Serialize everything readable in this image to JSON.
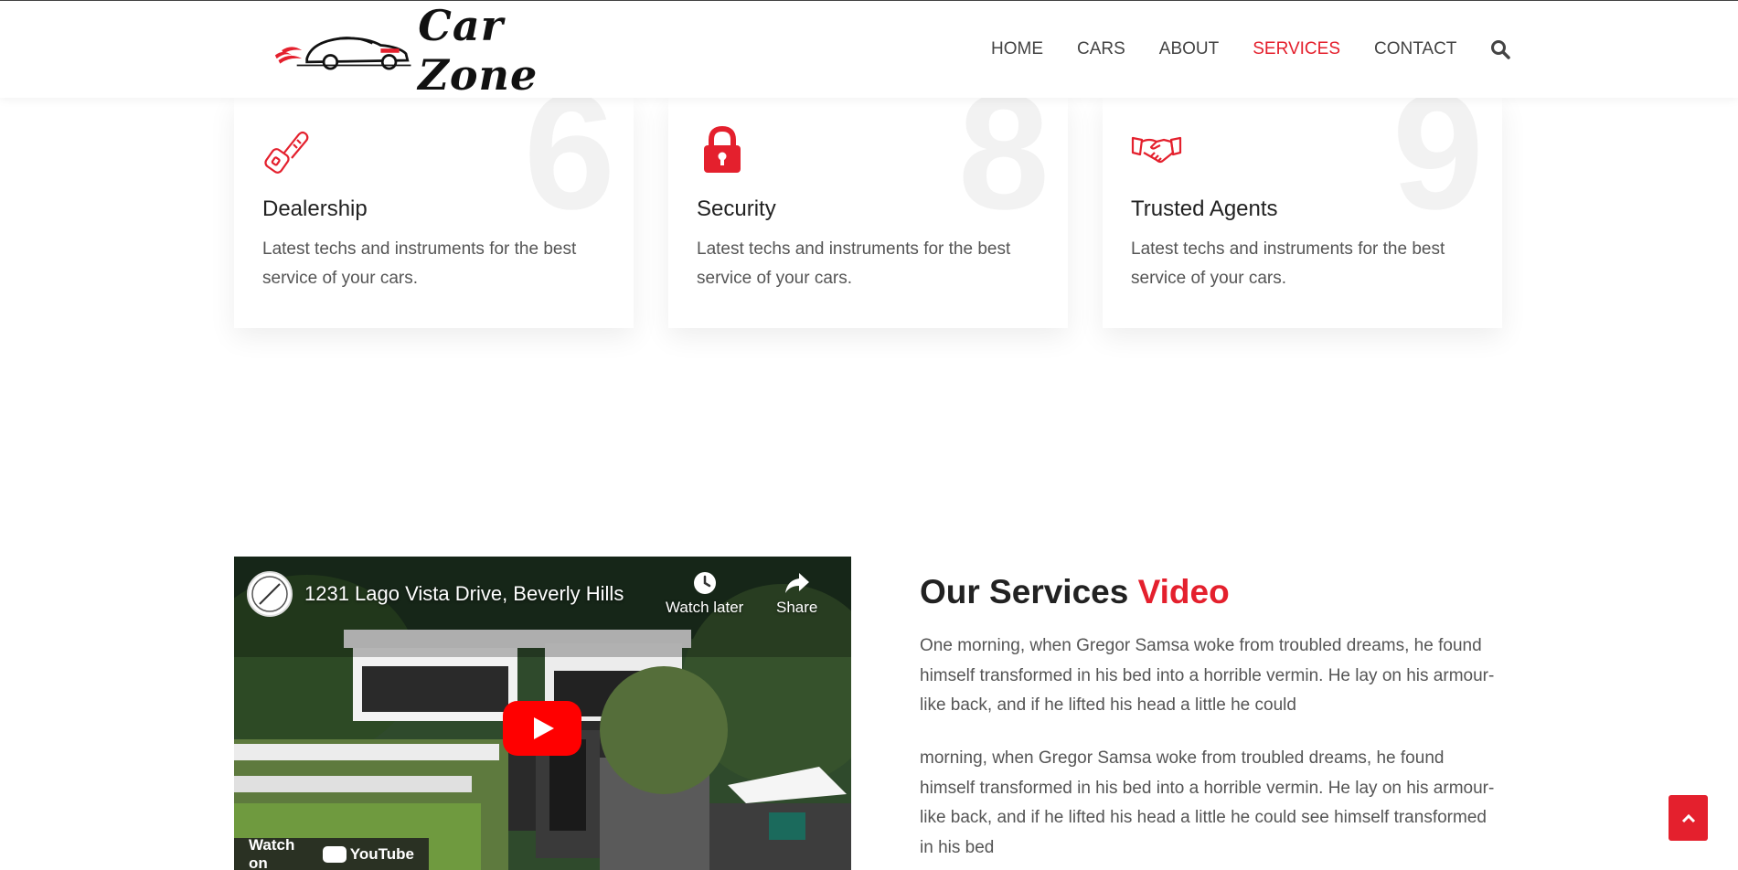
{
  "brand": {
    "name": "Car Zone"
  },
  "nav": {
    "items": [
      {
        "label": "HOME",
        "active": false
      },
      {
        "label": "CARS",
        "active": false
      },
      {
        "label": "ABOUT",
        "active": false
      },
      {
        "label": "SERVICES",
        "active": true
      },
      {
        "label": "CONTACT",
        "active": false
      }
    ],
    "search_icon": "search-icon"
  },
  "colors": {
    "accent": "#e4202d",
    "text": "#222222",
    "muted": "#555555"
  },
  "services": [
    {
      "number": "6",
      "icon": "key-icon",
      "title": "Dealership",
      "text": "Latest techs and instruments for the best service of your cars."
    },
    {
      "number": "8",
      "icon": "lock-icon",
      "title": "Security",
      "text": "Latest techs and instruments for the best service of your cars."
    },
    {
      "number": "9",
      "icon": "handshake-icon",
      "title": "Trusted Agents",
      "text": "Latest techs and instruments for the best service of your cars."
    }
  ],
  "video": {
    "title": "1231 Lago Vista Drive, Beverly Hills",
    "watch_later": "Watch later",
    "share": "Share",
    "watch_on": "Watch on",
    "youtube": "YouTube"
  },
  "section": {
    "title_main": "Our Services",
    "title_accent": "Video",
    "paragraph1": "One morning, when Gregor Samsa woke from troubled dreams, he found himself transformed in his bed into a horrible vermin. He lay on his armour-like back, and if he lifted his head a little he could",
    "paragraph2": "morning, when Gregor Samsa woke from troubled dreams, he found himself transformed in his bed into a horrible vermin. He lay on his armour-like back, and if he lifted his head a little he could see himself transformed in his bed"
  }
}
